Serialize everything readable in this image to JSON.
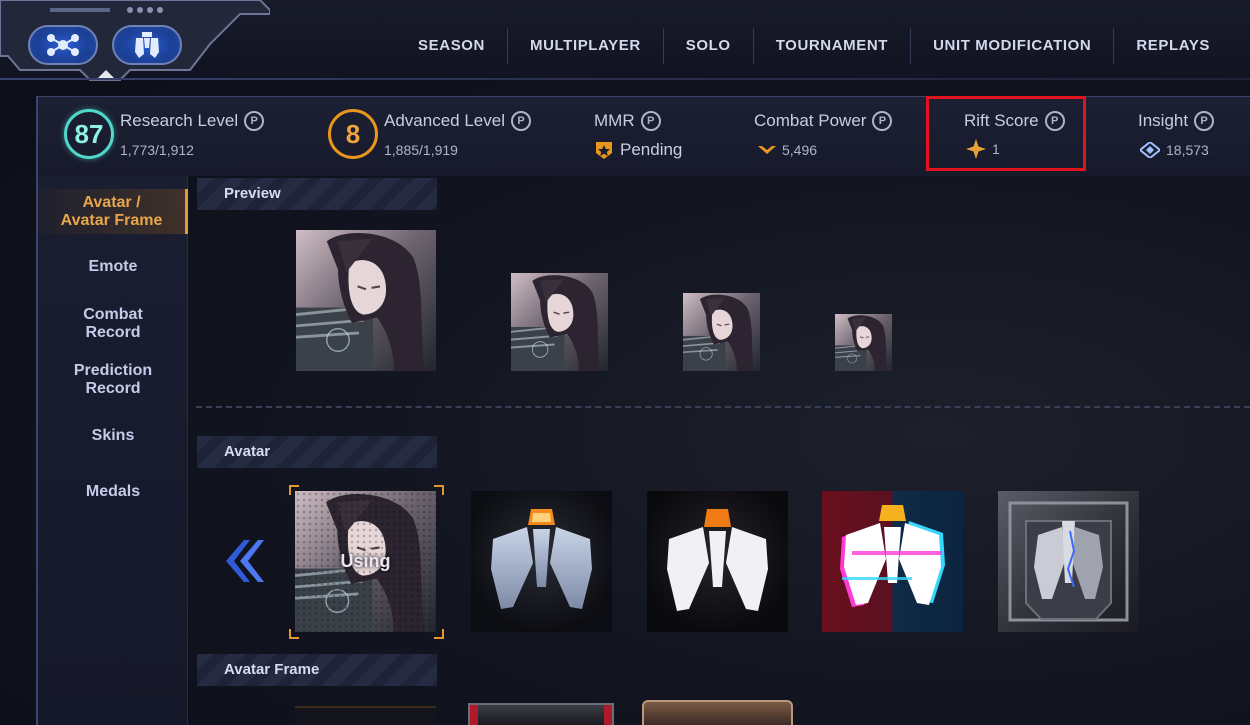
{
  "nav": {
    "items": [
      "SEASON",
      "MULTIPLAYER",
      "SOLO",
      "TOURNAMENT",
      "UNIT MODIFICATION",
      "REPLAYS"
    ]
  },
  "stats": {
    "research": {
      "level": "87",
      "title": "Research Level",
      "value": "1,773/1,912"
    },
    "advanced": {
      "level": "8",
      "title": "Advanced Level",
      "value": "1,885/1,919"
    },
    "mmr": {
      "title": "MMR",
      "value": "Pending"
    },
    "combat_power": {
      "title": "Combat Power",
      "value": "5,496"
    },
    "rift_score": {
      "title": "Rift Score",
      "value": "1"
    },
    "insight": {
      "title": "Insight",
      "value": "18,573"
    },
    "info_symbol": "P"
  },
  "sidebar": {
    "items": [
      {
        "line1": "Avatar /",
        "line2": "Avatar Frame"
      },
      {
        "line1": "Emote",
        "line2": ""
      },
      {
        "line1": "Combat",
        "line2": "Record"
      },
      {
        "line1": "Prediction",
        "line2": "Record"
      },
      {
        "line1": "Skins",
        "line2": ""
      },
      {
        "line1": "Medals",
        "line2": ""
      }
    ]
  },
  "sections": {
    "preview": "Preview",
    "avatar": "Avatar",
    "avatar_frame": "Avatar Frame"
  },
  "avatar_grid": {
    "using_label": "Using"
  },
  "colors": {
    "accent_orange": "#e29a3c",
    "highlight_red": "#e0131f",
    "research_ring": "#4fd8c9",
    "advanced_ring": "#e8961e"
  }
}
